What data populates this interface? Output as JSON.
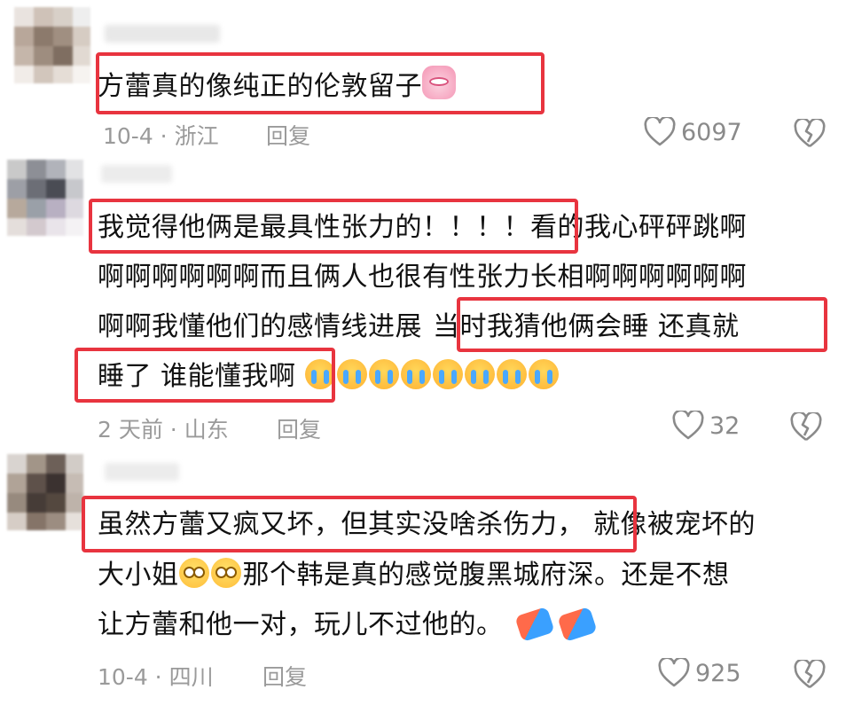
{
  "comments": [
    {
      "text_parts": [
        "方蕾真的像纯正的伦敦留子"
      ],
      "date_loc": "10-4 · 浙江",
      "reply": "回复",
      "likes": "6097"
    },
    {
      "line1_a": "我觉得他俩是最具性张力的！！！！",
      "line1_b": "看的我心砰砰跳啊",
      "line2": "啊啊啊啊啊啊而且俩人也很有性张力长相啊啊啊啊啊啊",
      "line3_a": "啊啊我懂他们的感情线进展",
      "line3_b": "当时我猜他俩会睡  还真就",
      "line4": "睡了 谁能懂我啊",
      "date_loc": "2 天前 · 山东",
      "reply": "回复",
      "likes": "32"
    },
    {
      "line1_a": "虽然方蕾又疯又坏，但其实没啥杀伤力，",
      "line1_b": "就像被宠坏的",
      "line2_a": "大小姐",
      "line2_b": "那个韩是真的感觉腹黑城府深。还是不想",
      "line3": "让方蕾和他一对，玩儿不过他的。",
      "date_loc": "10-4 · 四川",
      "reply": "回复",
      "likes": "925"
    }
  ],
  "icons": {
    "like": "heart-outline-icon",
    "dislike": "broken-heart-icon",
    "emoji_bunny": "pink-bunny-emoji",
    "emoji_cry": "crying-face-emoji",
    "emoji_shock": "flushed-face-emoji",
    "emoji_faint": "fainting-person-emoji"
  },
  "colors": {
    "highlight": "#e8343f",
    "meta_text": "#9a9a9a"
  }
}
